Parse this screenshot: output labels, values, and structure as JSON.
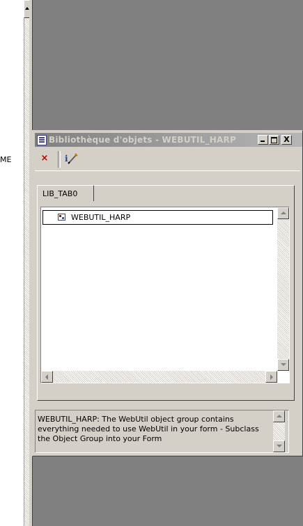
{
  "background_window": {
    "left_text": "ME"
  },
  "window": {
    "title": "Bibliothèque d'objets - WEBUTIL_HARP",
    "close_label": "X"
  },
  "toolbar": {
    "delete_glyph": "×",
    "delete_color": "#c00000"
  },
  "tabs": [
    {
      "label": "LIB_TAB0",
      "selected": true
    }
  ],
  "list": {
    "items": [
      {
        "label": "WEBUTIL_HARP",
        "icon": "object-group-icon",
        "selected": true
      }
    ]
  },
  "description": {
    "text": "WEBUTIL_HARP: The WebUtil object group contains everything needed to use WebUtil in your form - Subclass the Object Group into your Form"
  }
}
